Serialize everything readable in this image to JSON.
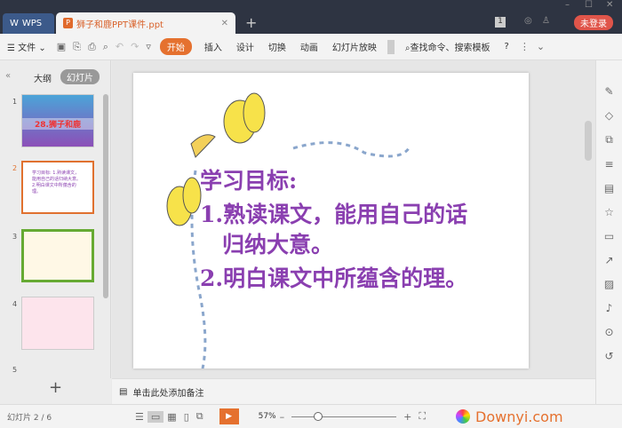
{
  "titlebar": {
    "app_tab": "WPS",
    "doc_tab": "狮子和鹿PPT课件.ppt",
    "login": "未登录",
    "badge": "1"
  },
  "toolbar": {
    "file": "文件",
    "tabs": [
      "开始",
      "插入",
      "设计",
      "切换",
      "动画",
      "幻灯片放映"
    ],
    "search": "查找命令、搜索模板",
    "help": "?"
  },
  "left": {
    "tab_outline": "大纲",
    "tab_slides": "幻灯片",
    "thumbs": [
      {
        "num": "1",
        "text": "28.狮子和鹿"
      },
      {
        "num": "2",
        "text": "学习目标: 1.熟读课文，能用自己的话归纳大意。2.明白课文中所蕴含的理。"
      },
      {
        "num": "3",
        "text": ""
      },
      {
        "num": "4",
        "text": ""
      },
      {
        "num": "5",
        "text": ""
      }
    ]
  },
  "slide": {
    "heading": "学习目标:",
    "line1": "1.熟读课文，能用自己的话",
    "line1b": "归纳大意。",
    "line2": "2.明白课文中所蕴含的理。"
  },
  "notes": {
    "placeholder": "单击此处添加备注"
  },
  "status": {
    "slide_info": "幻灯片 2 / 6",
    "zoom": "57%",
    "watermark": "Downyi.com"
  }
}
